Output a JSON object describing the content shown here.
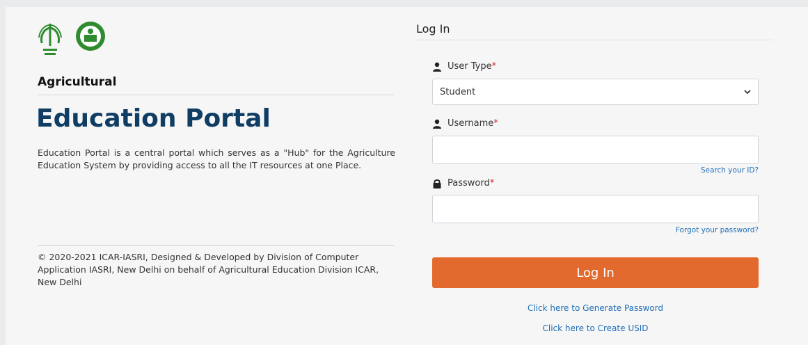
{
  "left": {
    "kicker": "Agricultural",
    "title": "Education Portal",
    "description": "Education Portal is a central portal which serves as a \"Hub\" for the Agriculture Education System by providing access to all the IT resources at one Place.",
    "footer": "© 2020-2021 ICAR-IASRI, Designed & Developed by Division of Computer Application IASRI, New Delhi on behalf of Agricultural Education Division ICAR, New Delhi"
  },
  "login": {
    "heading": "Log In",
    "user_type": {
      "label": "User Type",
      "required_mark": "*",
      "selected": "Student",
      "icon": "user-icon"
    },
    "username": {
      "label": "Username",
      "required_mark": "*",
      "value": "",
      "icon": "user-icon"
    },
    "search_id": "Search your ID?",
    "password": {
      "label": "Password",
      "required_mark": "*",
      "value": "",
      "icon": "lock-icon"
    },
    "forgot": "Forgot your password?",
    "submit": "Log In",
    "generate_link": "Click here to Generate Password",
    "create_usid_link": "Click here to Create USID"
  },
  "colors": {
    "title": "#0f3d63",
    "button": "#e36a2e",
    "link": "#1e6fb8",
    "required": "#d9232e"
  }
}
